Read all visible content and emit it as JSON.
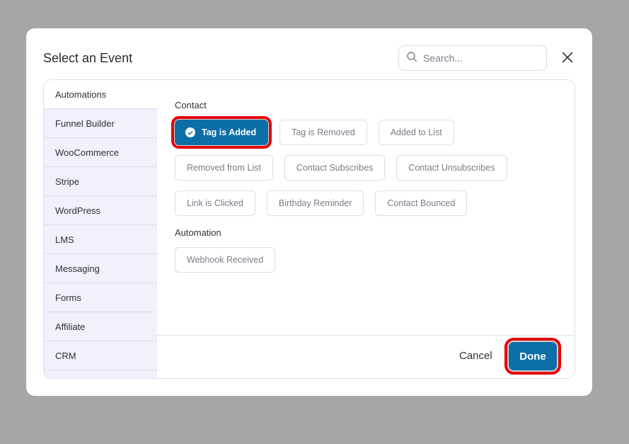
{
  "modal": {
    "title": "Select an Event",
    "search": {
      "placeholder": "Search...",
      "value": ""
    },
    "close_icon": "close-icon"
  },
  "sidebar": {
    "items": [
      {
        "label": "Automations",
        "active": true
      },
      {
        "label": "Funnel Builder",
        "active": false
      },
      {
        "label": "WooCommerce",
        "active": false
      },
      {
        "label": "Stripe",
        "active": false
      },
      {
        "label": "WordPress",
        "active": false
      },
      {
        "label": "LMS",
        "active": false
      },
      {
        "label": "Messaging",
        "active": false
      },
      {
        "label": "Forms",
        "active": false
      },
      {
        "label": "Affiliate",
        "active": false
      },
      {
        "label": "CRM",
        "active": false
      }
    ]
  },
  "groups": [
    {
      "title": "Contact",
      "events": [
        {
          "label": "Tag is Added",
          "selected": true
        },
        {
          "label": "Tag is Removed",
          "selected": false
        },
        {
          "label": "Added to List",
          "selected": false
        },
        {
          "label": "Removed from List",
          "selected": false
        },
        {
          "label": "Contact Subscribes",
          "selected": false
        },
        {
          "label": "Contact Unsubscribes",
          "selected": false
        },
        {
          "label": "Link is Clicked",
          "selected": false
        },
        {
          "label": "Birthday Reminder",
          "selected": false
        },
        {
          "label": "Contact Bounced",
          "selected": false
        }
      ]
    },
    {
      "title": "Automation",
      "events": [
        {
          "label": "Webhook Received",
          "selected": false
        }
      ]
    }
  ],
  "footer": {
    "cancel_label": "Cancel",
    "done_label": "Done"
  },
  "colors": {
    "primary": "#0c6ea6",
    "highlight": "#e60000",
    "sidebar_bg": "#f0f1fa",
    "overlay": "#a6a6a6"
  }
}
